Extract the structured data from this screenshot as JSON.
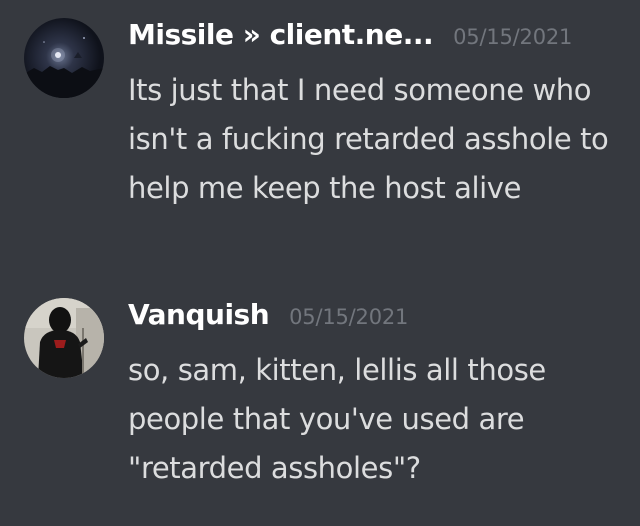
{
  "messages": [
    {
      "username": "Missile » client.ne...",
      "timestamp": "05/15/2021",
      "avatar_icon": "night-sky-avatar",
      "text": "Its just that I need someone who isn't a fucking retarded asshole to help me keep the host alive"
    },
    {
      "username": "Vanquish",
      "timestamp": "05/15/2021",
      "avatar_icon": "hooded-figure-avatar",
      "text": "so, sam, kitten, lellis all those people that you've used are \"retarded assholes\"?"
    }
  ],
  "colors": {
    "background": "#36393f",
    "username": "#ffffff",
    "timestamp": "#72767d",
    "message_text": "#dcddde"
  }
}
